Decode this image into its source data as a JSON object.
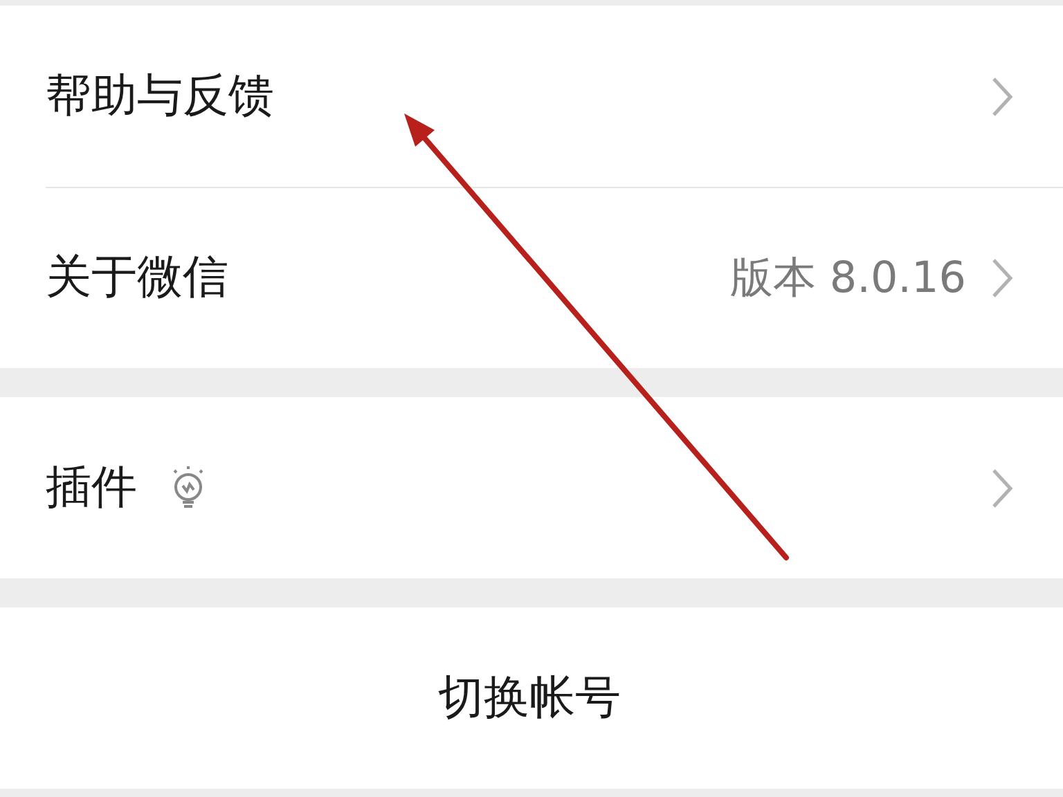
{
  "groups": [
    {
      "rows": [
        {
          "kind": "link",
          "label": "帮助与反馈"
        },
        {
          "kind": "link",
          "label": "关于微信",
          "value": "版本 8.0.16"
        }
      ]
    },
    {
      "rows": [
        {
          "kind": "plugin",
          "label": "插件"
        }
      ]
    },
    {
      "rows": [
        {
          "kind": "action",
          "label": "切换帐号"
        }
      ]
    }
  ]
}
